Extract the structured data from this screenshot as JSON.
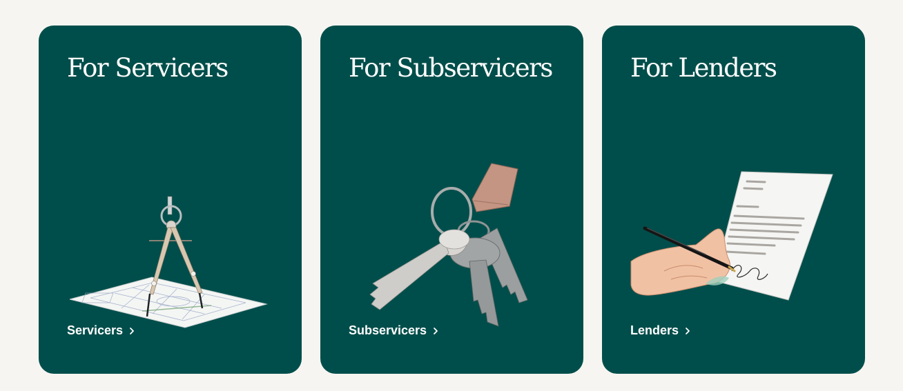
{
  "cards": [
    {
      "title": "For Servicers",
      "link_label": "Servicers",
      "illustration": "drafting-compass-icon"
    },
    {
      "title": "For Subservicers",
      "link_label": "Subservicers",
      "illustration": "keys-icon"
    },
    {
      "title": "For Lenders",
      "link_label": "Lenders",
      "illustration": "signing-document-icon"
    }
  ],
  "colors": {
    "background": "#f7f5f1",
    "card": "#004e4b",
    "text": "#ffffff"
  },
  "icons": {
    "link_arrow": "chevron-right-icon"
  }
}
